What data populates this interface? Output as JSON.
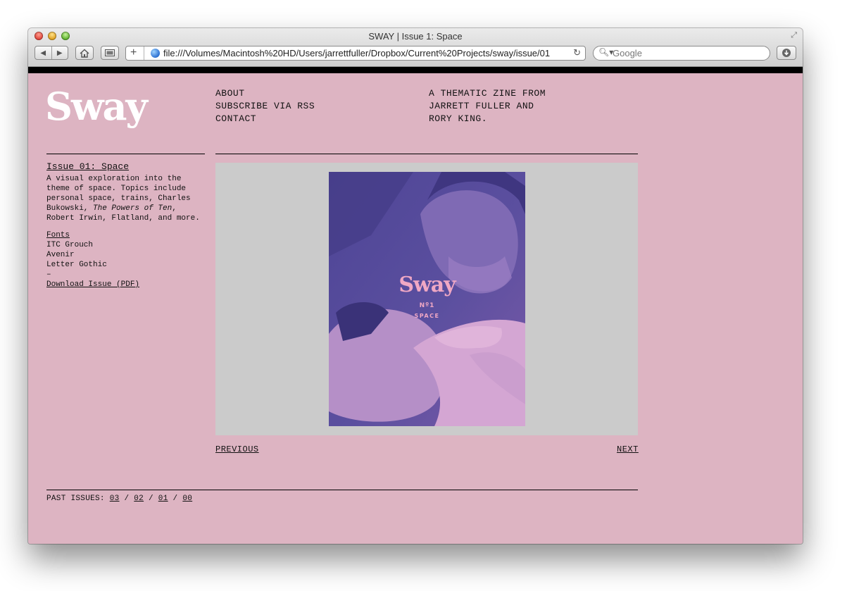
{
  "browser": {
    "title": "SWAY | Issue 1: Space",
    "url": "file:///Volumes/Macintosh%20HD/Users/jarrettfuller/Dropbox/Current%20Projects/sway/issue/01",
    "search_placeholder": "Google"
  },
  "site": {
    "logo": "Sway",
    "nav": [
      "ABOUT",
      "SUBSCRIBE VIA RSS",
      "CONTACT"
    ],
    "tagline": [
      "A THEMATIC ZINE FROM",
      "JARRETT FULLER AND",
      "RORY KING."
    ]
  },
  "issue": {
    "title": "Issue 01: Space",
    "desc_before": "A visual exploration into the theme of space. Topics include personal space, trains, Charles Bukowski, ",
    "desc_italic": "The Powers of Ten",
    "desc_after": ", Robert Irwin, Flatland, and more.",
    "fonts_heading": "Fonts",
    "fonts": [
      "ITC Grouch",
      "Avenir",
      "Letter Gothic"
    ],
    "dash": "–",
    "download": "Download Issue (PDF)"
  },
  "cover": {
    "title": "Sway",
    "number": "Nº1",
    "subtitle": "SPACE"
  },
  "pager": {
    "previous": "PREVIOUS",
    "next": "NEXT"
  },
  "past_issues": {
    "label": "PAST ISSUES:",
    "issues": [
      "03",
      "02",
      "01",
      "00"
    ],
    "separator": "/"
  },
  "colors": {
    "page_bg": "#ddb4c2",
    "cover_panel": "#cbcbcb",
    "cover_duotone_dark": "#5a4fa0",
    "cover_duotone_light": "#d7a3d0",
    "logo": "#ffffff"
  }
}
